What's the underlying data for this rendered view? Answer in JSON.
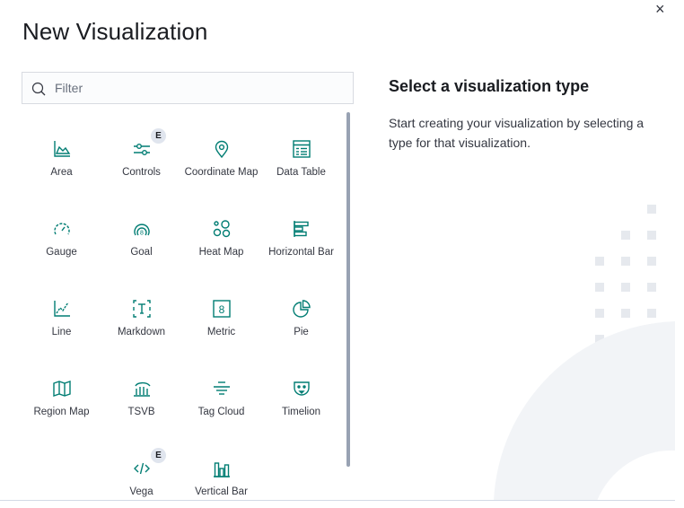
{
  "modal": {
    "title": "New Visualization",
    "close_icon": "close-icon",
    "close_glyph": "×"
  },
  "search": {
    "placeholder": "Filter",
    "value": "",
    "icon": "search-icon"
  },
  "types": [
    {
      "label": "Area",
      "icon": "area-chart-icon"
    },
    {
      "label": "Controls",
      "icon": "controls-icon",
      "badge": "E"
    },
    {
      "label": "Coordinate Map",
      "icon": "map-pin-icon"
    },
    {
      "label": "Data Table",
      "icon": "data-table-icon"
    },
    {
      "label": "Gauge",
      "icon": "gauge-icon"
    },
    {
      "label": "Goal",
      "icon": "goal-icon"
    },
    {
      "label": "Heat Map",
      "icon": "heatmap-icon"
    },
    {
      "label": "Horizontal Bar",
      "icon": "horizontal-bar-icon"
    },
    {
      "label": "Line",
      "icon": "line-chart-icon"
    },
    {
      "label": "Markdown",
      "icon": "markdown-icon"
    },
    {
      "label": "Metric",
      "icon": "metric-icon"
    },
    {
      "label": "Pie",
      "icon": "pie-chart-icon"
    },
    {
      "label": "Region Map",
      "icon": "region-map-icon"
    },
    {
      "label": "TSVB",
      "icon": "tsvb-icon"
    },
    {
      "label": "Tag Cloud",
      "icon": "tag-cloud-icon"
    },
    {
      "label": "Timelion",
      "icon": "timelion-icon"
    },
    {
      "label": "Vega",
      "icon": "vega-icon",
      "badge": "E"
    },
    {
      "label": "Vertical Bar",
      "icon": "vertical-bar-icon"
    }
  ],
  "side_panel": {
    "title": "Select a visualization type",
    "description": "Start creating your visualization by selecting a type for that visualization."
  },
  "colors": {
    "icon": "#017d73",
    "text": "#343741",
    "badge_bg": "#e0e5ee",
    "illustration": "#f2f4f7",
    "dots": "#e6e9ee"
  }
}
